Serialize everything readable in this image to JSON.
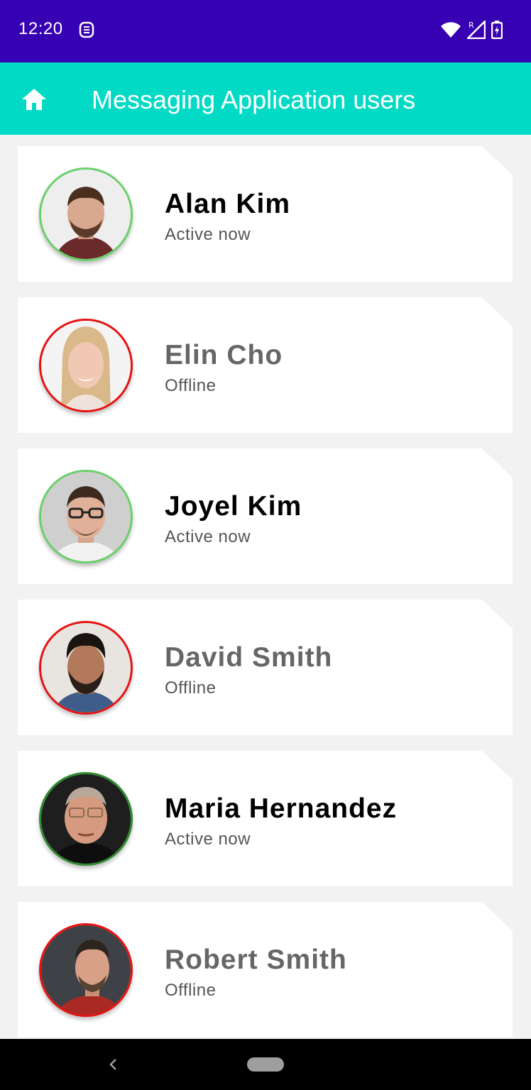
{
  "status_bar": {
    "time": "12:20",
    "icons": [
      "notification-icon",
      "wifi-icon",
      "signal-icon",
      "battery-charging-icon"
    ]
  },
  "app_bar": {
    "title": "Messaging Application users",
    "icon": "home-icon",
    "color": "#03dac5"
  },
  "users": [
    {
      "name": "Alan Kim",
      "status": "Active now",
      "online": true
    },
    {
      "name": "Elin Cho",
      "status": "Offline",
      "online": false
    },
    {
      "name": "Joyel Kim",
      "status": "Active now",
      "online": true
    },
    {
      "name": "David Smith",
      "status": "Offline",
      "online": false
    },
    {
      "name": "Maria Hernandez",
      "status": "Active now",
      "online": true
    },
    {
      "name": "Robert Smith",
      "status": "Offline",
      "online": false
    }
  ],
  "colors": {
    "status_bar": "#3700b3",
    "online_ring": "#6ad06a",
    "offline_ring": "#e81010"
  }
}
